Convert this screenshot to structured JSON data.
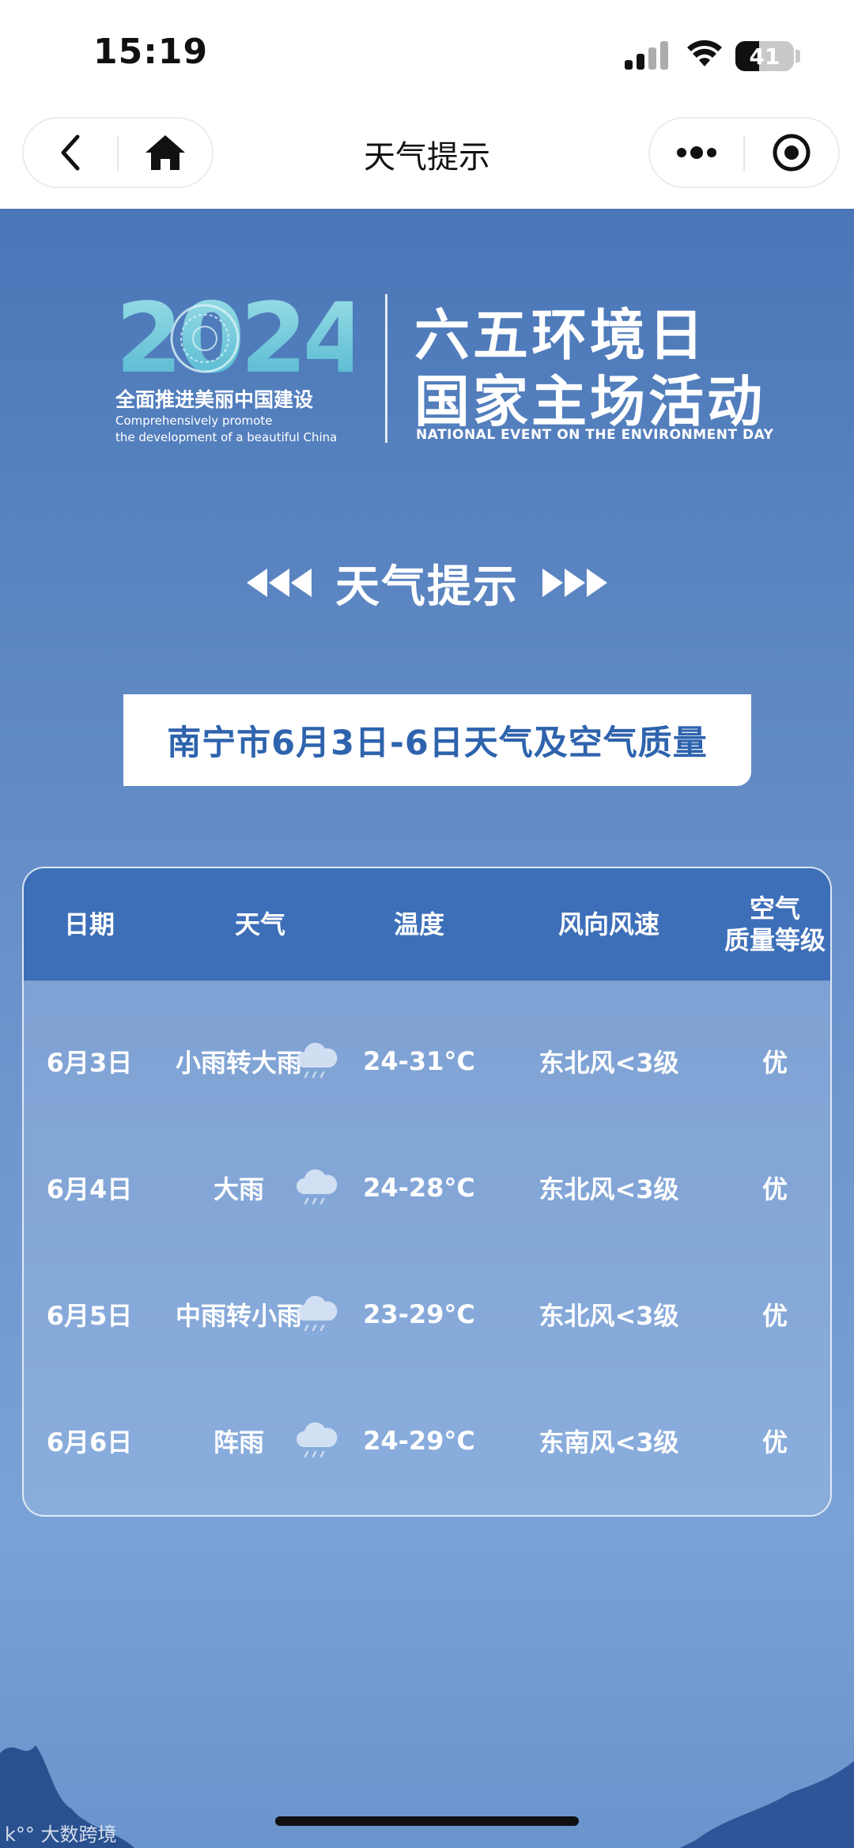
{
  "status_bar": {
    "time": "15:19",
    "battery": "41",
    "battery_level": 0.41
  },
  "nav": {
    "title": "天气提示"
  },
  "poster": {
    "logo_year": "2024",
    "logo_subtitle_cn": "全面推进美丽中国建设",
    "logo_subtitle_en_line1": "Comprehensively promote",
    "logo_subtitle_en_line2": "the development of a beautiful China",
    "event_line1": "六五环境日",
    "event_line2": "国家主场活动",
    "event_en": "NATIONAL EVENT ON THE ENVIRONMENT DAY",
    "section_title": "天气提示",
    "banner": "南宁市6月3日-6日天气及空气质量"
  },
  "table": {
    "headers": [
      "日期",
      "天气",
      "温度",
      "风向风速",
      "空气\n质量等级"
    ],
    "rows": [
      {
        "date": "6月3日",
        "weather": "小雨转大雨",
        "icon": "rain-cloud-icon",
        "temp": "24-31°C",
        "wind": "东北风<3级",
        "aqi": "优"
      },
      {
        "date": "6月4日",
        "weather": "大雨",
        "icon": "rain-cloud-icon",
        "temp": "24-28°C",
        "wind": "东北风<3级",
        "aqi": "优"
      },
      {
        "date": "6月5日",
        "weather": "中雨转小雨",
        "icon": "rain-cloud-icon",
        "temp": "23-29°C",
        "wind": "东北风<3级",
        "aqi": "优"
      },
      {
        "date": "6月6日",
        "weather": "阵雨",
        "icon": "rain-cloud-icon",
        "temp": "24-29°C",
        "wind": "东南风<3级",
        "aqi": "优"
      }
    ]
  },
  "watermark": "大数跨境",
  "colors": {
    "poster_blue": "#4a77b8",
    "header_blue": "#3d6fb9",
    "banner_text": "#2e63ad"
  }
}
